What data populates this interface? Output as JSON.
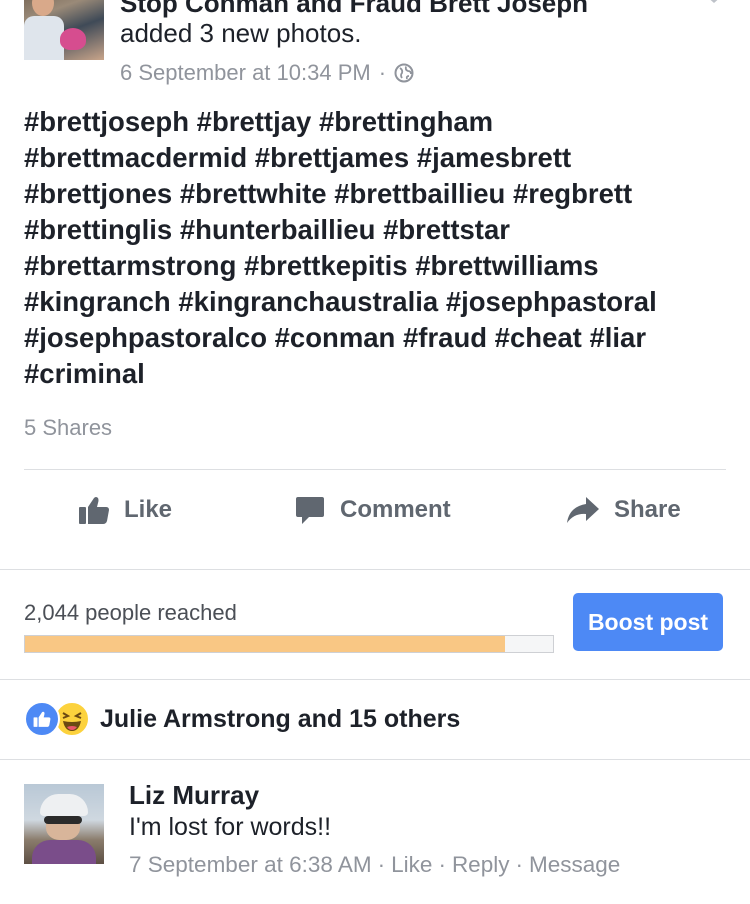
{
  "post": {
    "page_name": "Stop Conman and Fraud Brett Joseph",
    "action_text": "added 3 new photos.",
    "timestamp": "6 September at 10:34 PM",
    "privacy_icon": "globe-icon",
    "text_lines": [
      "#brettjoseph #brettjay #brettingham",
      "#brettmacdermid #brettjames #jamesbrett",
      "#brettjones #brettwhite #brettbaillieu #regbrett",
      "#brettinglis #hunterbaillieu #brettstar",
      "#brettarmstrong #brettkepitis #brettwilliams",
      "#kingranch #kingranchaustralia #josephpastoral",
      "#josephpastoralco #conman #fraud #cheat #liar",
      "#criminal"
    ],
    "shares": "5 Shares"
  },
  "actions": {
    "like": "Like",
    "comment": "Comment",
    "share": "Share"
  },
  "reach": {
    "label": "2,044 people reached",
    "progress_fraction": 0.91,
    "boost_label": "Boost post"
  },
  "reactions": {
    "icons": [
      "like-reaction-icon",
      "haha-reaction-icon"
    ],
    "summary": "Julie Armstrong and 15 others"
  },
  "comment": {
    "author": "Liz Murray",
    "text": "I'm lost for words!!",
    "timestamp": "7 September at 6:38 AM",
    "like": "Like",
    "reply": "Reply",
    "message": "Message"
  },
  "colors": {
    "accent": "#4d89f5",
    "progress": "#f9c784",
    "muted_text": "#90949c"
  }
}
